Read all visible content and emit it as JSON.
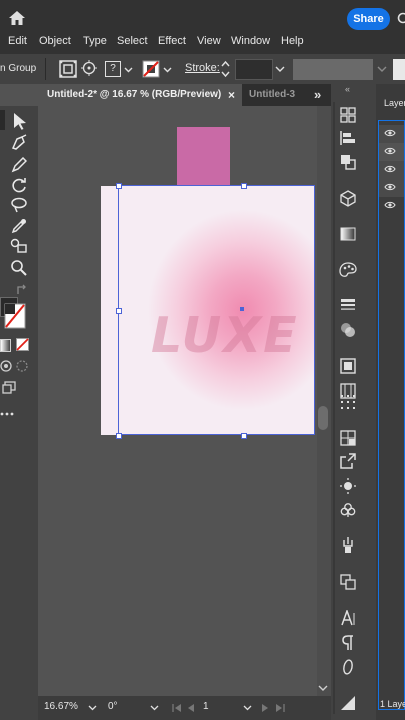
{
  "top_bar": {
    "share_label": "Share"
  },
  "menu": {
    "items": [
      "Edit",
      "Object",
      "Type",
      "Select",
      "Effect",
      "View",
      "Window",
      "Help"
    ]
  },
  "control_bar": {
    "group_label": "n Group",
    "stroke_label": "Stroke:",
    "fill_menu_value": "?"
  },
  "tabs": [
    {
      "label": "Untitled-2* @ 16.67 % (RGB/Preview)",
      "close": "×"
    },
    {
      "label": "Untitled-3"
    }
  ],
  "tab_overflow": "»",
  "layers_panel": {
    "title": "Layer",
    "footer": "1 Laye"
  },
  "artwork": {
    "text": "LUXE",
    "pink_color": "#c96aa6"
  },
  "status_bar": {
    "zoom": "16.67%",
    "rotation": "0°",
    "artboard_number": "1"
  },
  "colors": {
    "accent": "#1473e6",
    "ui_dark": "#323232",
    "panel": "#424242",
    "canvas_bg": "#535353"
  }
}
